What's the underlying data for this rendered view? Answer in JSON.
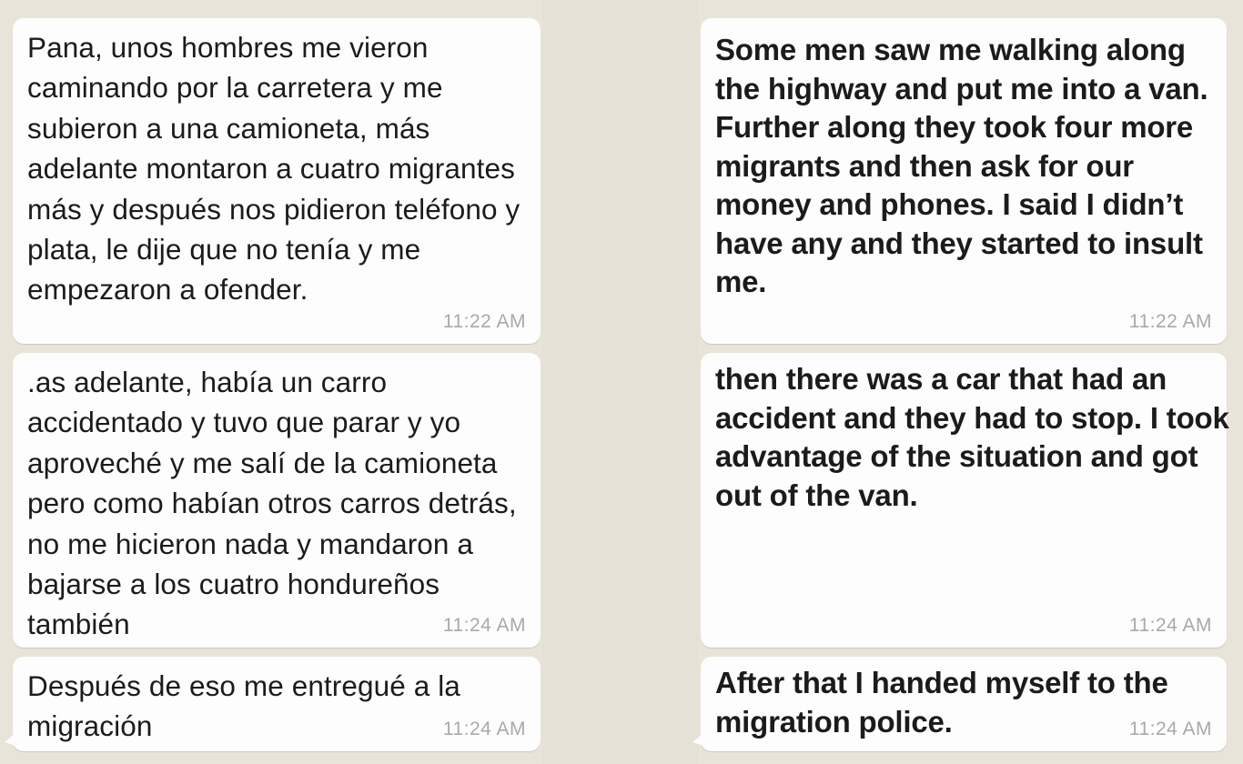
{
  "colors": {
    "chat_background": "#e9e4da",
    "bubble": "#fdfdfd",
    "text": "#1b1b1b",
    "timestamp": "#a9a9a9"
  },
  "original": {
    "messages": [
      {
        "text": "Pana, unos hombres me vieron caminando por la carretera y me subieron a una camioneta, más adelante montaron a cuatro migrantes más y después nos pidieron teléfono y plata, le dije que no tenía y me empezaron a ofender.",
        "time": "11:22 AM"
      },
      {
        "text": ".as adelante, había un carro accidentado y tuvo que parar y yo aproveché y me salí de la camioneta pero como habían otros carros detrás, no me hicieron nada y mandaron a bajarse a los cuatro hondureños también",
        "time": "11:24 AM"
      },
      {
        "text": "Después de eso me entregué a la migración",
        "time": "11:24 AM"
      }
    ]
  },
  "translation": {
    "messages": [
      {
        "text": "Some men saw me walking along the highway and put me into a van. Further along they took four more migrants and then ask for our money and phones. I said I didn’t have any and they started to insult me.",
        "time": "11:22 AM"
      },
      {
        "text": "then there was a car that had an accident and they had to stop. I took advantage of the situation and got out of the van.",
        "time": "11:24 AM"
      },
      {
        "text": "After that I handed myself to the migration police.",
        "time": "11:24 AM"
      }
    ]
  }
}
